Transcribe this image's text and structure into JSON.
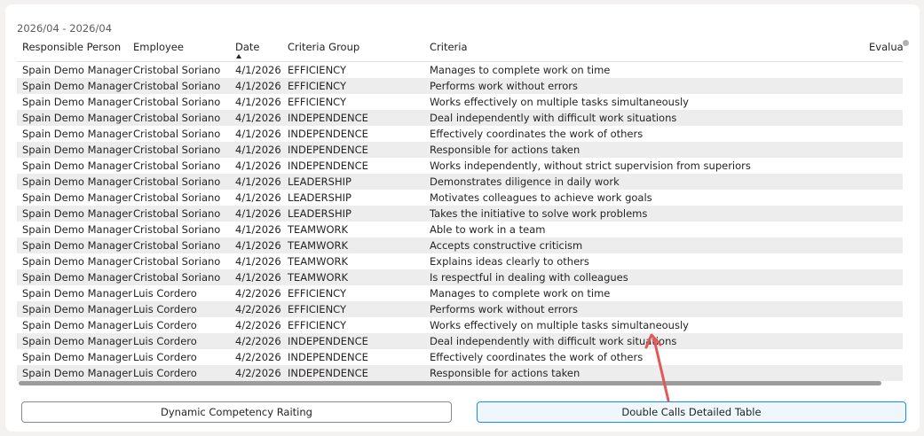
{
  "period_label": "2026/04 - 2026/04",
  "table": {
    "columns": [
      "Responsible Person",
      "Employee",
      "Date",
      "Criteria Group",
      "Criteria",
      "Evaluat"
    ],
    "sorted_column": "Date",
    "rows": [
      [
        "Spain Demo Manager",
        "Cristobal Soriano",
        "4/1/2026",
        "EFFICIENCY",
        "Manages to complete work on time"
      ],
      [
        "Spain Demo Manager",
        "Cristobal Soriano",
        "4/1/2026",
        "EFFICIENCY",
        "Performs work without errors"
      ],
      [
        "Spain Demo Manager",
        "Cristobal Soriano",
        "4/1/2026",
        "EFFICIENCY",
        "Works effectively on multiple tasks simultaneously"
      ],
      [
        "Spain Demo Manager",
        "Cristobal Soriano",
        "4/1/2026",
        "INDEPENDENCE",
        "Deal independently with difficult work situations"
      ],
      [
        "Spain Demo Manager",
        "Cristobal Soriano",
        "4/1/2026",
        "INDEPENDENCE",
        "Effectively coordinates the work of others"
      ],
      [
        "Spain Demo Manager",
        "Cristobal Soriano",
        "4/1/2026",
        "INDEPENDENCE",
        "Responsible for actions taken"
      ],
      [
        "Spain Demo Manager",
        "Cristobal Soriano",
        "4/1/2026",
        "INDEPENDENCE",
        "Works independently, without strict supervision from superiors"
      ],
      [
        "Spain Demo Manager",
        "Cristobal Soriano",
        "4/1/2026",
        "LEADERSHIP",
        "Demonstrates diligence in daily work"
      ],
      [
        "Spain Demo Manager",
        "Cristobal Soriano",
        "4/1/2026",
        "LEADERSHIP",
        "Motivates colleagues to achieve work goals"
      ],
      [
        "Spain Demo Manager",
        "Cristobal Soriano",
        "4/1/2026",
        "LEADERSHIP",
        "Takes the initiative to solve work problems"
      ],
      [
        "Spain Demo Manager",
        "Cristobal Soriano",
        "4/1/2026",
        "TEAMWORK",
        "Able to work in a team"
      ],
      [
        "Spain Demo Manager",
        "Cristobal Soriano",
        "4/1/2026",
        "TEAMWORK",
        "Accepts constructive criticism"
      ],
      [
        "Spain Demo Manager",
        "Cristobal Soriano",
        "4/1/2026",
        "TEAMWORK",
        "Explains ideas clearly to others"
      ],
      [
        "Spain Demo Manager",
        "Cristobal Soriano",
        "4/1/2026",
        "TEAMWORK",
        "Is respectful in dealing with colleagues"
      ],
      [
        "Spain Demo Manager",
        "Luis Cordero",
        "4/2/2026",
        "EFFICIENCY",
        "Manages to complete work on time"
      ],
      [
        "Spain Demo Manager",
        "Luis Cordero",
        "4/2/2026",
        "EFFICIENCY",
        "Performs work without errors"
      ],
      [
        "Spain Demo Manager",
        "Luis Cordero",
        "4/2/2026",
        "EFFICIENCY",
        "Works effectively on multiple tasks simultaneously"
      ],
      [
        "Spain Demo Manager",
        "Luis Cordero",
        "4/2/2026",
        "INDEPENDENCE",
        "Deal independently with difficult work situations"
      ],
      [
        "Spain Demo Manager",
        "Luis Cordero",
        "4/2/2026",
        "INDEPENDENCE",
        "Effectively coordinates the work of others"
      ],
      [
        "Spain Demo Manager",
        "Luis Cordero",
        "4/2/2026",
        "INDEPENDENCE",
        "Responsible for actions taken"
      ]
    ]
  },
  "buttons": {
    "dynamic_label": "Dynamic Competency Raiting",
    "detailed_label": "Double Calls Detailed Table"
  },
  "colors": {
    "row_alt": "#eeeded",
    "active_button_border": "#118dff",
    "annotation_arrow": "#e05a5a"
  },
  "icons": {
    "sort": "sort-ascending-icon",
    "annotation": "annotation-arrow-icon"
  }
}
